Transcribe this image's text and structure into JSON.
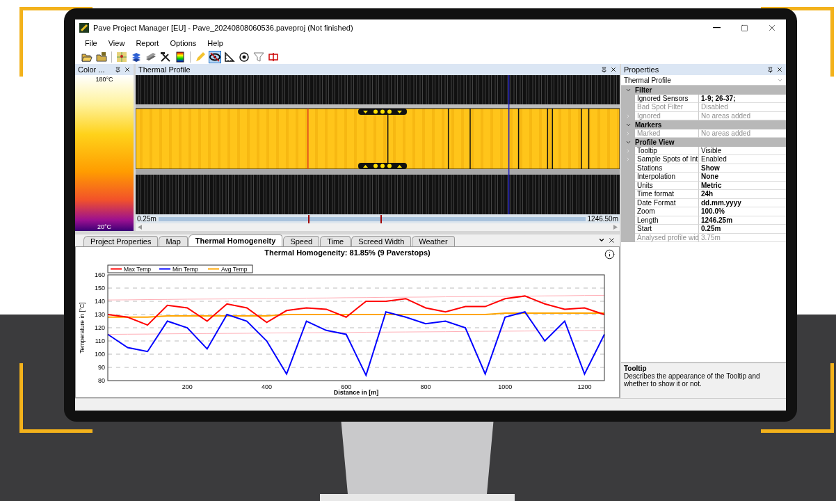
{
  "window": {
    "title": "Pave Project Manager [EU] - Pave_20240808060536.paveproj (Not finished)"
  },
  "menu": [
    "File",
    "View",
    "Report",
    "Options",
    "Help"
  ],
  "toolbar": [
    {
      "kind": "open",
      "selected": false
    },
    {
      "kind": "open-project",
      "selected": false
    },
    {
      "kind": "separator"
    },
    {
      "kind": "map",
      "selected": false
    },
    {
      "kind": "layers",
      "selected": false
    },
    {
      "kind": "screed",
      "selected": false
    },
    {
      "kind": "tools",
      "selected": false
    },
    {
      "kind": "palette",
      "selected": false
    },
    {
      "kind": "separator"
    },
    {
      "kind": "pencil",
      "selected": false
    },
    {
      "kind": "hide",
      "selected": true
    },
    {
      "kind": "ruler",
      "selected": false
    },
    {
      "kind": "target",
      "selected": false
    },
    {
      "kind": "filter",
      "selected": false
    },
    {
      "kind": "split",
      "selected": false
    }
  ],
  "color_scale": {
    "title": "Color ...",
    "max": "180°C",
    "min": "20°C"
  },
  "thermal_profile": {
    "title": "Thermal Profile",
    "start": "0.25m",
    "end": "1246.50m"
  },
  "bottom_tabs": [
    {
      "label": "Project Properties",
      "selected": false
    },
    {
      "label": "Map",
      "selected": false
    },
    {
      "label": "Thermal Homogeneity",
      "selected": true
    },
    {
      "label": "Speed",
      "selected": false
    },
    {
      "label": "Time",
      "selected": false
    },
    {
      "label": "Screed Width",
      "selected": false
    },
    {
      "label": "Weather",
      "selected": false
    }
  ],
  "chart": {
    "title": "Thermal Homogeneity: 81.85% (9 Paverstops)",
    "chart_data": {
      "type": "line",
      "xlabel": "Distance in [m]",
      "ylabel": "Temperature in [°C]",
      "x": [
        0,
        50,
        100,
        150,
        200,
        250,
        300,
        350,
        400,
        450,
        500,
        550,
        600,
        650,
        700,
        750,
        800,
        850,
        900,
        950,
        1000,
        1050,
        1100,
        1150,
        1200,
        1250
      ],
      "series": [
        {
          "name": "Max Temp",
          "color": "#ff0000",
          "values": [
            130,
            128,
            122,
            137,
            135,
            125,
            138,
            135,
            124,
            133,
            135,
            134,
            128,
            140,
            140,
            142,
            135,
            132,
            136,
            136,
            142,
            144,
            138,
            134,
            135,
            130
          ]
        },
        {
          "name": "Min Temp",
          "color": "#0000ff",
          "values": [
            115,
            105,
            102,
            125,
            120,
            104,
            130,
            125,
            110,
            85,
            125,
            118,
            115,
            84,
            132,
            128,
            123,
            125,
            120,
            85,
            128,
            132,
            110,
            125,
            85,
            115
          ]
        },
        {
          "name": "Avg Temp",
          "color": "#ffa500",
          "values": [
            128,
            128,
            128,
            129,
            129,
            129,
            129,
            129,
            129,
            130,
            130,
            130,
            130,
            130,
            130,
            130,
            130,
            130,
            130,
            130,
            131,
            131,
            131,
            131,
            131,
            131
          ]
        },
        {
          "color": "#ffb0b8",
          "values": [
            141,
            141.1,
            141.3,
            141.4,
            141.6,
            141.7,
            141.8,
            142,
            142.1,
            142.3,
            142.4,
            142.5,
            142.7,
            142.8,
            143,
            143.1,
            143.2,
            143.4,
            143.5,
            143.7,
            143.8,
            143.9,
            144.1,
            144.2,
            144.4,
            144.5
          ]
        },
        {
          "color": "#ffb0b8",
          "values": [
            115,
            115.1,
            115.2,
            115.4,
            115.5,
            115.6,
            115.7,
            115.8,
            116,
            116.1,
            116.2,
            116.3,
            116.4,
            116.6,
            116.7,
            116.8,
            116.9,
            117,
            117.2,
            117.3,
            117.4,
            117.5,
            117.6,
            117.8,
            117.9,
            118
          ]
        }
      ],
      "grid": true,
      "legend": "top-left",
      "xlim": [
        0,
        1250
      ],
      "ylim": [
        80,
        160
      ],
      "xticks": [
        200,
        400,
        600,
        800,
        1000,
        1200
      ],
      "yticks": [
        80,
        90,
        100,
        110,
        120,
        130,
        140,
        150,
        160
      ]
    }
  },
  "properties": {
    "title": "Properties",
    "object": "Thermal Profile",
    "categories": [
      {
        "name": "Filter",
        "expanded": true,
        "rows": [
          {
            "name": "Ignored Sensors",
            "value": "1-9; 26-37;",
            "modified": true,
            "disabled": false,
            "has_children": false
          },
          {
            "name": "Bad Spot Filter",
            "value": "Disabled",
            "modified": false,
            "disabled": true,
            "has_children": false
          },
          {
            "name": "Ignored",
            "value": "No areas added",
            "modified": false,
            "disabled": true,
            "has_children": true
          }
        ]
      },
      {
        "name": "Markers",
        "expanded": true,
        "rows": [
          {
            "name": "Marked",
            "value": "No areas added",
            "modified": false,
            "disabled": true,
            "has_children": true
          }
        ]
      },
      {
        "name": "Profile View",
        "expanded": true,
        "rows": [
          {
            "name": "Tooltip",
            "value": "Visible",
            "modified": false,
            "disabled": false,
            "has_children": true
          },
          {
            "name": "Sample Spots of Int",
            "value": "Enabled",
            "modified": false,
            "disabled": false,
            "has_children": true
          },
          {
            "name": "Stations",
            "value": "Show",
            "modified": true,
            "disabled": false,
            "has_children": false
          },
          {
            "name": "Interpolation",
            "value": "None",
            "modified": true,
            "disabled": false,
            "has_children": false
          },
          {
            "name": "Units",
            "value": "Metric",
            "modified": true,
            "disabled": false,
            "has_children": false
          },
          {
            "name": "Time format",
            "value": "24h",
            "modified": true,
            "disabled": false,
            "has_children": false
          },
          {
            "name": "Date Format",
            "value": "dd.mm.yyyy",
            "modified": true,
            "disabled": false,
            "has_children": false
          },
          {
            "name": "Zoom",
            "value": "100.0%",
            "modified": true,
            "disabled": false,
            "has_children": false
          },
          {
            "name": "Length",
            "value": "1246.25m",
            "modified": true,
            "disabled": false,
            "has_children": false
          },
          {
            "name": "Start",
            "value": "0.25m",
            "modified": true,
            "disabled": false,
            "has_children": false
          },
          {
            "name": "Analysed profile wid",
            "value": "3.75m",
            "modified": false,
            "disabled": true,
            "has_children": false
          }
        ]
      }
    ]
  },
  "help": {
    "title": "Tooltip",
    "text": "Describes the appearance of the Tooltip and whether to show it or not."
  }
}
